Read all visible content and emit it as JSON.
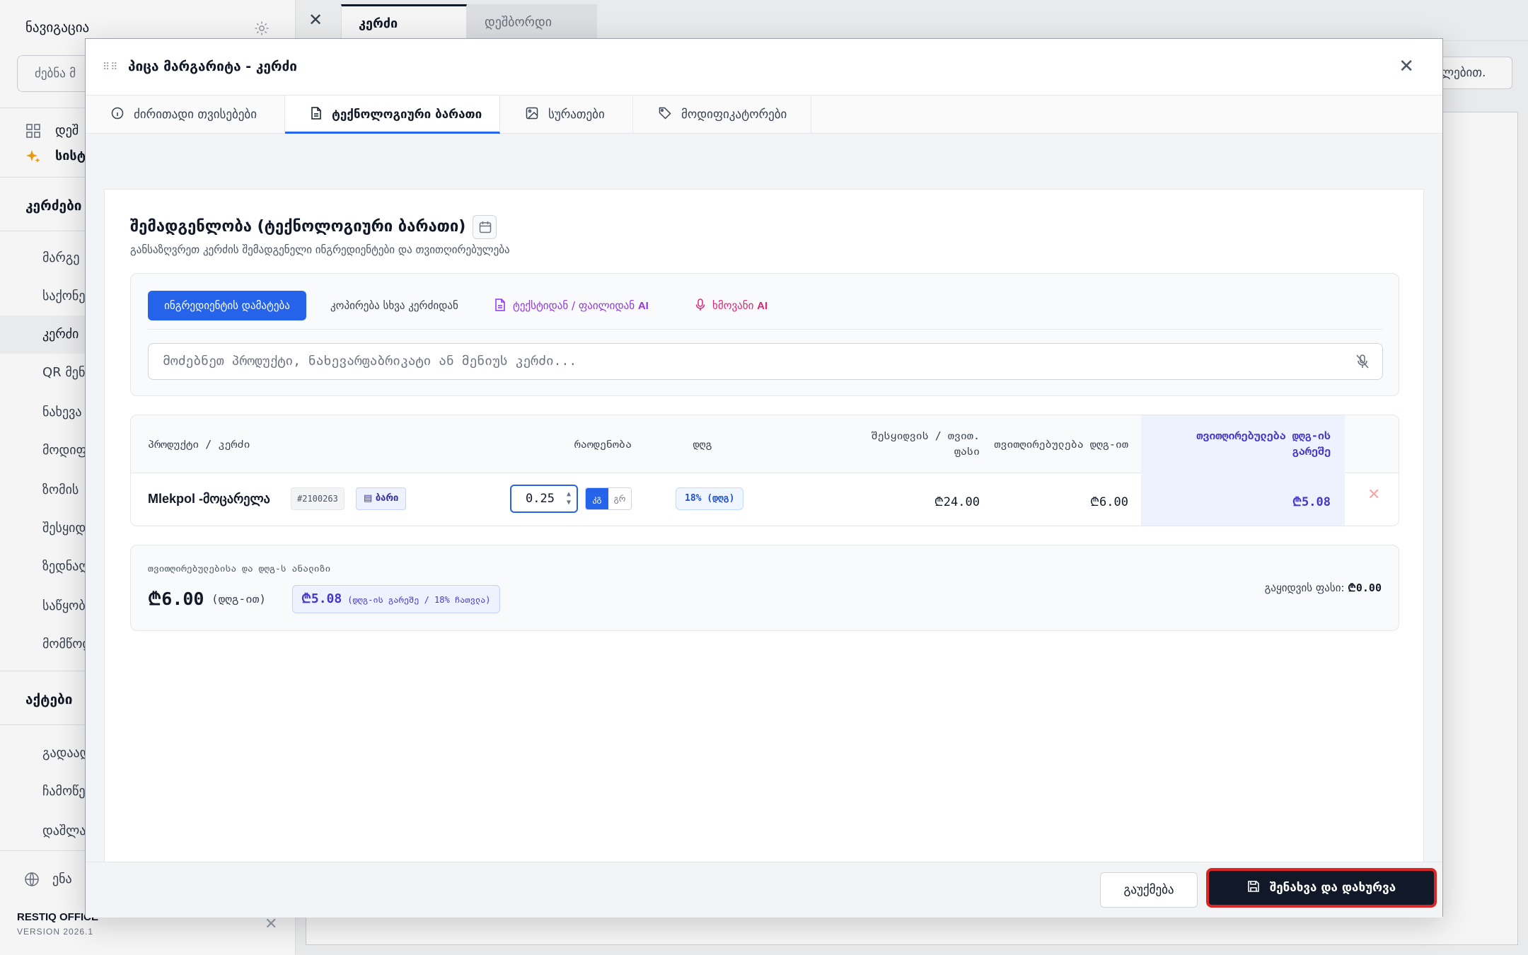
{
  "sidebar": {
    "title": "ნავიგაცია",
    "search_placeholder": "ძებნა მ",
    "pinned": [
      {
        "label": "დეშ",
        "icon": "grid-icon"
      },
      {
        "label": "სისტ",
        "icon": "sparkles-icon"
      }
    ],
    "sections": [
      {
        "label": "კერძები",
        "items": [
          "მარგე",
          "საქონე",
          "კერძი",
          "QR მენ",
          "ნახევა",
          "მოდიფ",
          "ზომის",
          "შესყიდ",
          "ზედნაღ",
          "საწყობ",
          "მომწოდ"
        ]
      },
      {
        "label": "აქტები",
        "items": [
          "გადაად",
          "ჩამოწე",
          "დაშლა"
        ]
      }
    ],
    "language_label": "ენა",
    "brand": "RESTIQ OFFICE",
    "version": "VERSION 2026.1"
  },
  "doc_tabs": {
    "active": "კერძი",
    "inactive": "დეშბორდი"
  },
  "bg_right_button": "ლებით.",
  "modal": {
    "title": "პიცა მარგარიტა - კერძი",
    "tabs": [
      {
        "label": "ძირითადი თვისებები",
        "icon": "info-icon"
      },
      {
        "label": "ტექნოლოგიური ბარათი",
        "icon": "document-icon"
      },
      {
        "label": "სურათები",
        "icon": "image-icon"
      },
      {
        "label": "მოდიფიკატორები",
        "icon": "tag-icon"
      }
    ],
    "section_title": "შემადგენლობა (ტექნოლოგიური ბარათი)",
    "section_subtitle": "განსაზღვრეთ კერძის შემადგენელი ინგრედიენტები და თვითღირებულება",
    "add_ingredient": "ინგრედიენტის დამატება",
    "copy_from_dish": "კოპირება სხვა კერძიდან",
    "from_text_file": "ტექსტიდან / ფაილიდან",
    "ai_label": "AI",
    "voice": "ხმოვანი",
    "search_placeholder": "მოძებნეთ პროდუქტი, ნახევარფაბრიკატი ან მენიუს კერძი...",
    "table": {
      "headers": {
        "product": "პროდუქტი / კერძი",
        "quantity": "რაოდენობა",
        "vat": "დღგ",
        "purchase_line1": "შესყიდვის / თვით.",
        "purchase_line2": "ფასი",
        "cost_with_vat": "თვითღირებულება დღგ-ით",
        "cost_no_vat_line1": "თვითღირებულება დღგ-ის",
        "cost_no_vat_line2": "გარეშე"
      },
      "rows": [
        {
          "product": "Mlekpol -მოცარელა",
          "sku": "#2100263",
          "warehouse": "ბარი",
          "quantity": "0.25",
          "unit_kg": "კგ",
          "unit_g": "გრ",
          "vat": "18% (დღგ)",
          "purchase_price": "₾24.00",
          "cost_with_vat": "₾6.00",
          "cost_no_vat": "₾5.08"
        }
      ]
    },
    "summary": {
      "label": "თვითღირებულებისა და დღგ-ს ანალიზი",
      "total_with_vat": "₾6.00",
      "total_with_vat_note": "(დღგ-ით)",
      "total_no_vat": "₾5.08",
      "total_no_vat_note": "(დღგ-ის გარეშე / 18% ჩათვლა)",
      "sale_price_label": "გაყიდვის ფასი:",
      "sale_price": "₾0.00"
    },
    "cancel": "გაუქმება",
    "save_close": "შენახვა და დახურვა"
  },
  "colors": {
    "primary": "#2563eb",
    "dark": "#111827",
    "highlight": "#dc2626",
    "ai_purple": "#9333ea",
    "voice_pink": "#db2777"
  }
}
